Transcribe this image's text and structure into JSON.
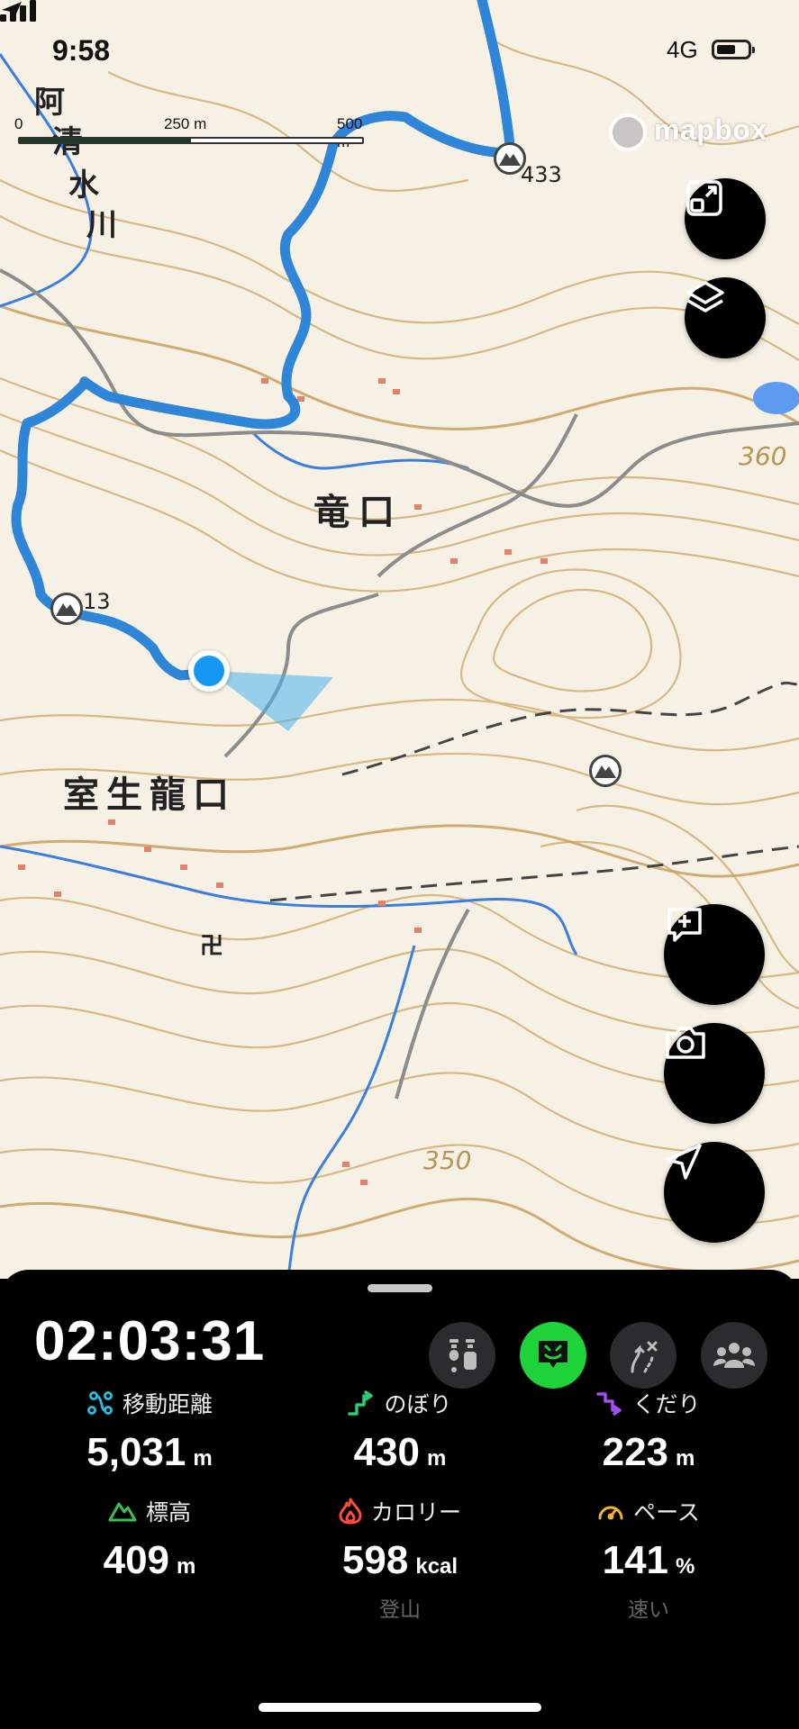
{
  "status_bar": {
    "time": "9:58",
    "network": "4G"
  },
  "map": {
    "scale": {
      "labels": [
        "0",
        "250 m",
        "500 m"
      ]
    },
    "attribution": "mapbox",
    "place_labels": [
      "阿",
      "清",
      "水",
      "川",
      "竜口",
      "室生龍口",
      "卍"
    ],
    "elevation_labels": [
      "433",
      "13",
      "360",
      "350"
    ],
    "colors": {
      "route": "#2f86d8",
      "contour": "#c9a96a",
      "water": "#3a7ee0",
      "road": "#8a8a8a",
      "user_dot": "#1597f2"
    },
    "icons": [
      "expand-icon",
      "layers-icon",
      "add-note-icon",
      "camera-icon",
      "navigate-icon",
      "peak-icon"
    ]
  },
  "panel": {
    "elapsed_time": "02:03:31",
    "stats": [
      {
        "label": "移動距離",
        "value": "5,031",
        "unit": "m",
        "icon": "distance-icon",
        "icon_color": "#2fb8d6"
      },
      {
        "label": "のぼり",
        "value": "430",
        "unit": "m",
        "icon": "ascent-icon",
        "icon_color": "#2ecc71"
      },
      {
        "label": "くだり",
        "value": "223",
        "unit": "m",
        "icon": "descent-icon",
        "icon_color": "#a64df0"
      },
      {
        "label": "標高",
        "value": "409",
        "unit": "m",
        "icon": "elevation-icon",
        "icon_color": "#37c05a"
      },
      {
        "label": "カロリー",
        "value": "598",
        "unit": "kcal",
        "sub": "登山",
        "icon": "calorie-icon",
        "icon_color": "#ff4b3a"
      },
      {
        "label": "ペース",
        "value": "141",
        "unit": "%",
        "sub": "速い",
        "icon": "pace-icon",
        "icon_color": "#f3b52c"
      }
    ],
    "active_mode_color": "#1ed33a"
  }
}
